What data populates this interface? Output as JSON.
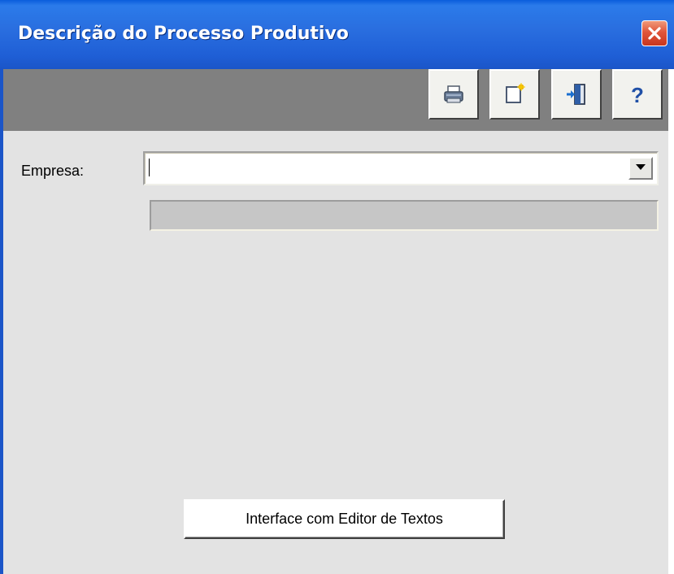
{
  "window": {
    "title": "Descrição do Processo Produtivo"
  },
  "toolbar": {
    "buttons": [
      {
        "name": "print",
        "icon": "printer-icon"
      },
      {
        "name": "edit",
        "icon": "edit-document-icon"
      },
      {
        "name": "exit",
        "icon": "exit-door-icon"
      },
      {
        "name": "help",
        "icon": "question-mark-icon",
        "glyph": "?"
      }
    ]
  },
  "form": {
    "empresa_label": "Empresa:",
    "empresa_value": "",
    "empresa_description": ""
  },
  "actions": {
    "editor_button_label": "Interface com Editor de Textos"
  },
  "colors": {
    "titlebar": "#1f5fd6",
    "toolbar_bg": "#808080",
    "client_bg": "#e3e3e3",
    "close_button": "#e0553a"
  }
}
